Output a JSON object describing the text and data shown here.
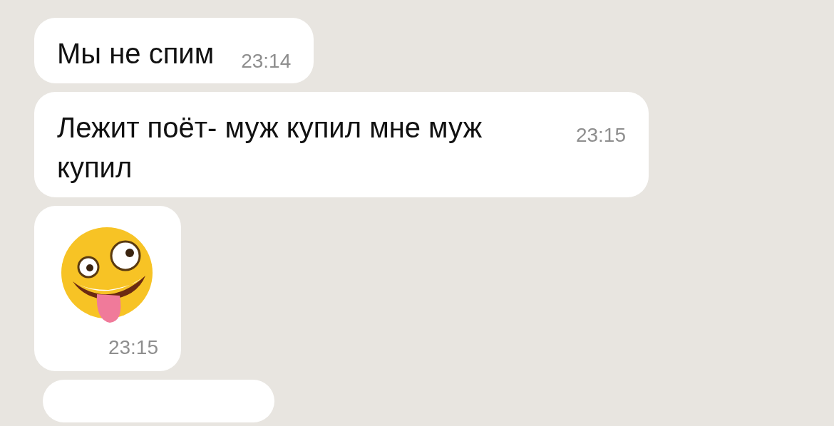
{
  "messages": [
    {
      "kind": "text",
      "text": "Мы не спим",
      "time": "23:14"
    },
    {
      "kind": "text",
      "text": "Лежит поёт- муж купил мне муж купил",
      "time": "23:15"
    },
    {
      "kind": "emoji",
      "time": "23:15"
    },
    {
      "kind": "cut"
    }
  ]
}
